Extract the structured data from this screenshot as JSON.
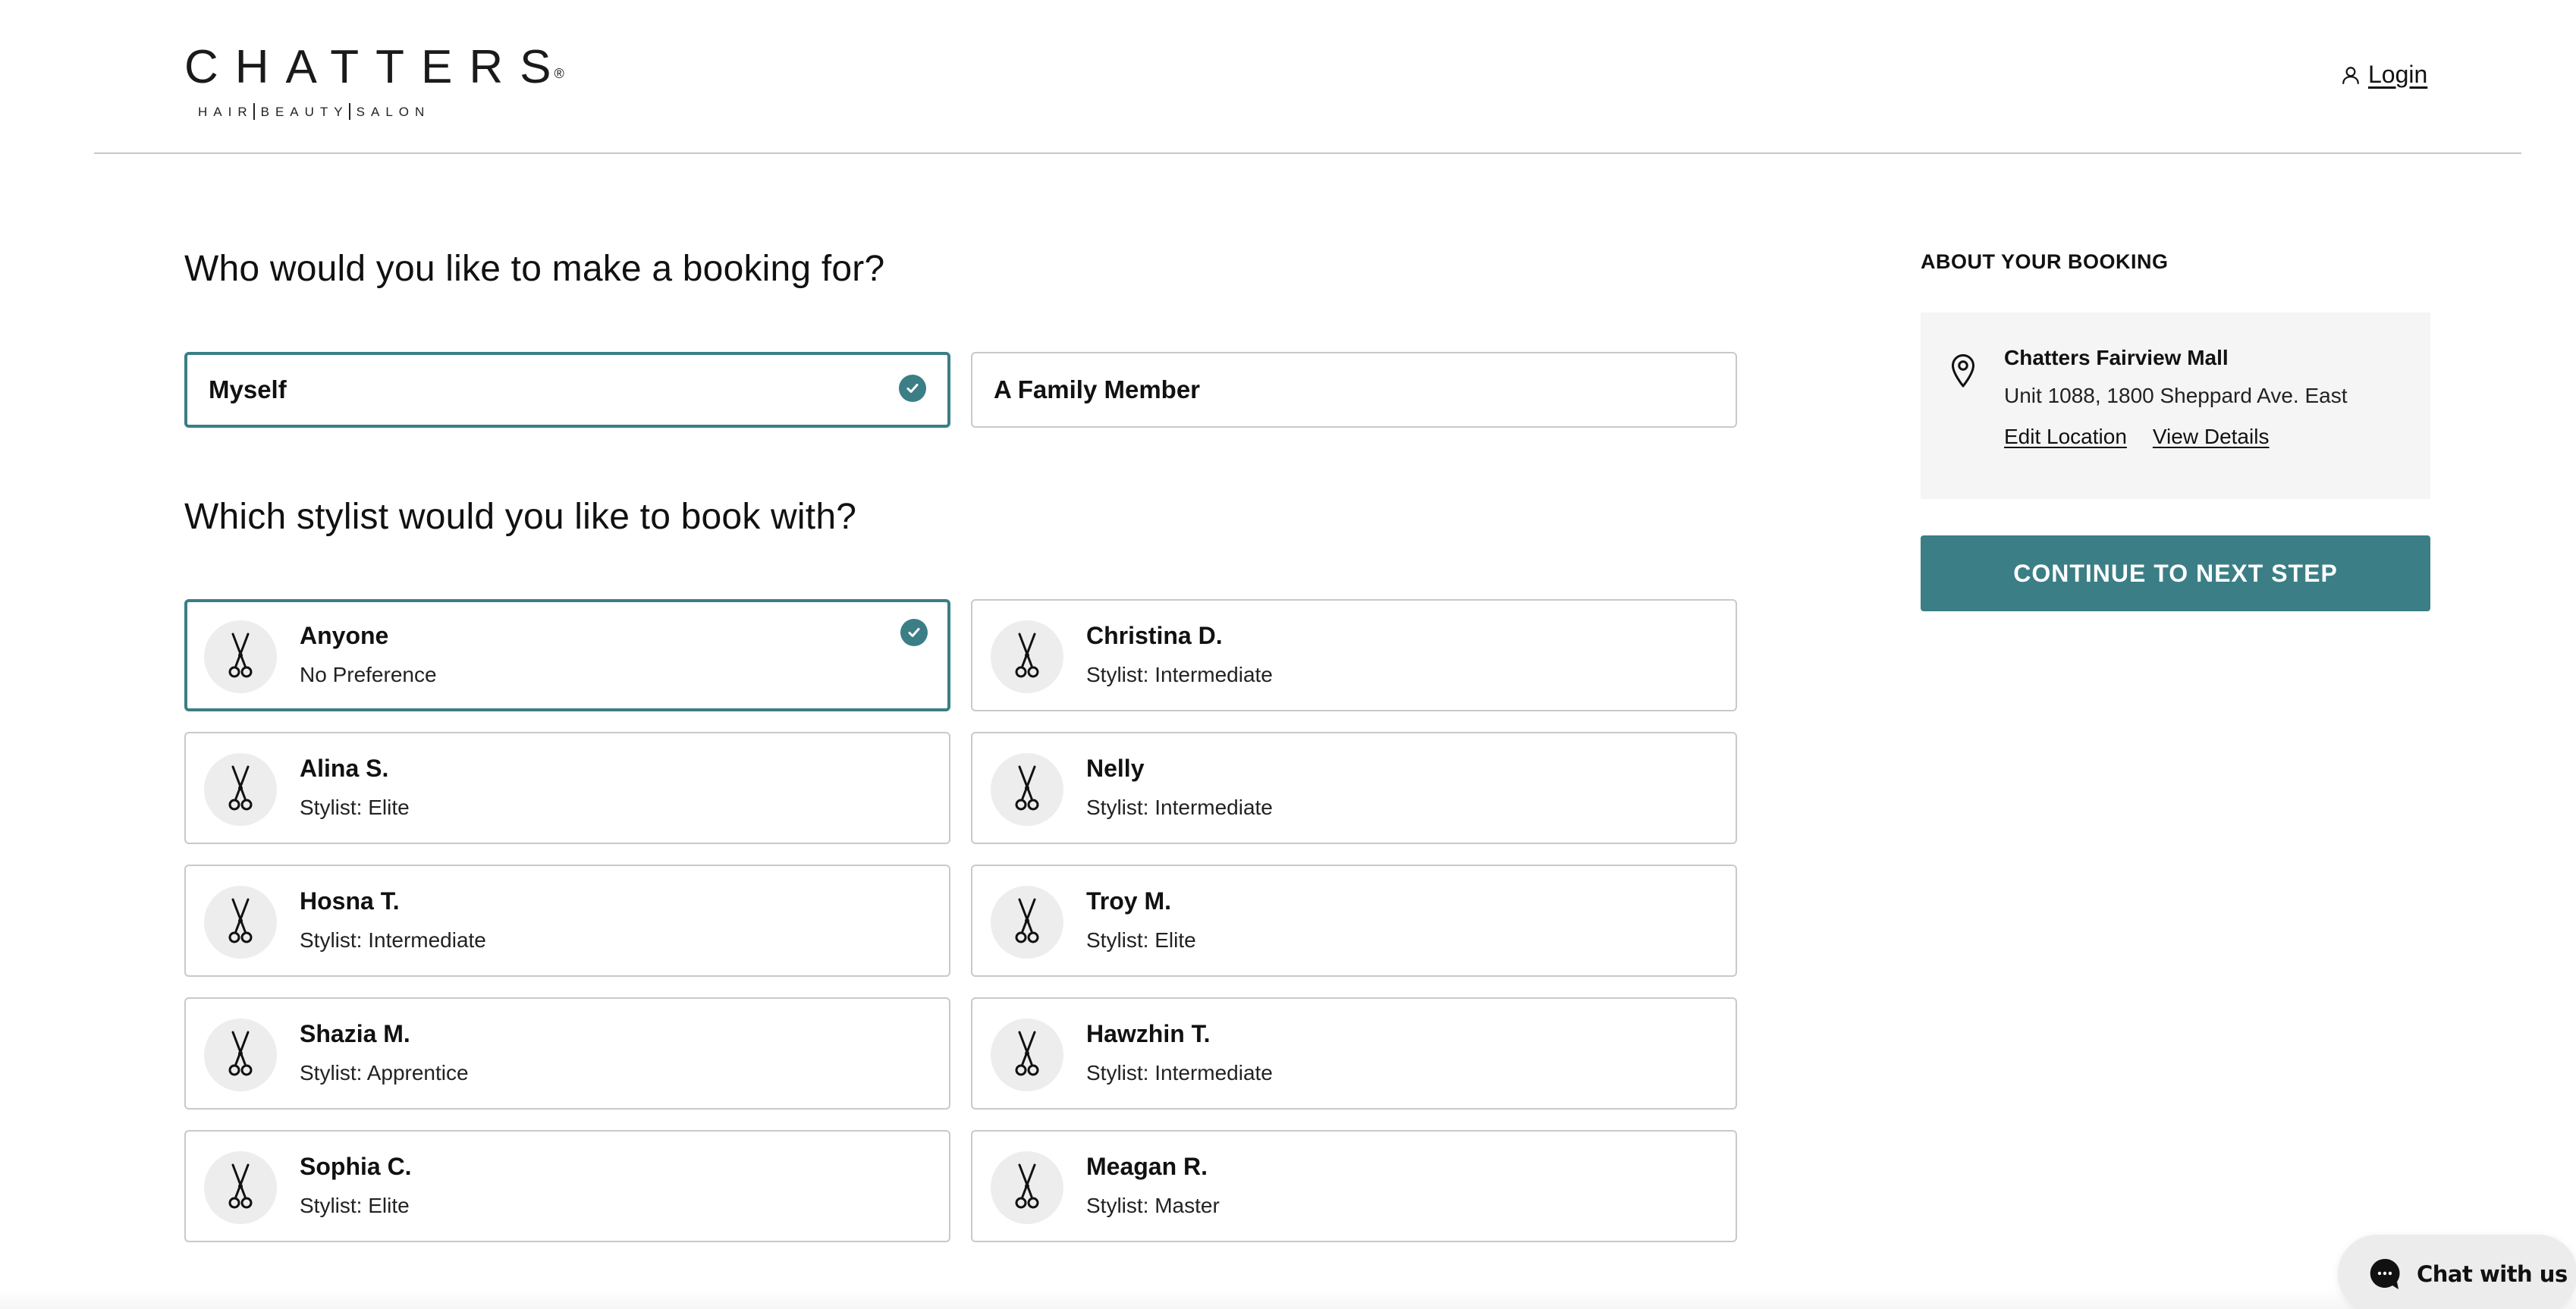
{
  "brand": {
    "name": "CHATTERS",
    "registered_mark": "®",
    "tagline_parts": [
      "HAIR",
      "BEAUTY",
      "SALON"
    ]
  },
  "header": {
    "login_label": "Login",
    "login_icon": "user-icon"
  },
  "booking_for": {
    "title": "Who would you like to make a booking for?",
    "options": [
      {
        "label": "Myself",
        "selected": true
      },
      {
        "label": "A Family Member",
        "selected": false
      }
    ]
  },
  "stylists": {
    "title": "Which stylist would you like to book with?",
    "icon": "scissors-icon",
    "items": [
      {
        "name": "Anyone",
        "level": "No Preference",
        "selected": true
      },
      {
        "name": "Christina D.",
        "level": "Stylist: Intermediate",
        "selected": false
      },
      {
        "name": "Alina S.",
        "level": "Stylist: Elite",
        "selected": false
      },
      {
        "name": "Nelly",
        "level": "Stylist: Intermediate",
        "selected": false
      },
      {
        "name": "Hosna T.",
        "level": "Stylist: Intermediate",
        "selected": false
      },
      {
        "name": "Troy M.",
        "level": "Stylist: Elite",
        "selected": false
      },
      {
        "name": "Shazia M.",
        "level": "Stylist: Apprentice",
        "selected": false
      },
      {
        "name": "Hawzhin T.",
        "level": "Stylist: Intermediate",
        "selected": false
      },
      {
        "name": "Sophia C.",
        "level": "Stylist: Elite",
        "selected": false
      },
      {
        "name": "Meagan R.",
        "level": "Stylist: Master",
        "selected": false
      }
    ]
  },
  "sidebar": {
    "title": "ABOUT YOUR BOOKING",
    "location": {
      "icon": "map-pin-icon",
      "name": "Chatters Fairview Mall",
      "address": "Unit 1088, 1800 Sheppard Ave. East",
      "edit_label": "Edit Location",
      "details_label": "View Details"
    },
    "continue_label": "CONTINUE TO NEXT STEP"
  },
  "chat": {
    "label": "Chat with us",
    "icon": "chat-bubble-icon"
  },
  "colors": {
    "accent": "#3b7e86",
    "card_border": "#c9c9c9",
    "panel_bg": "#f5f5f5",
    "avatar_bg": "#ededed",
    "chat_bg": "#ececec"
  }
}
